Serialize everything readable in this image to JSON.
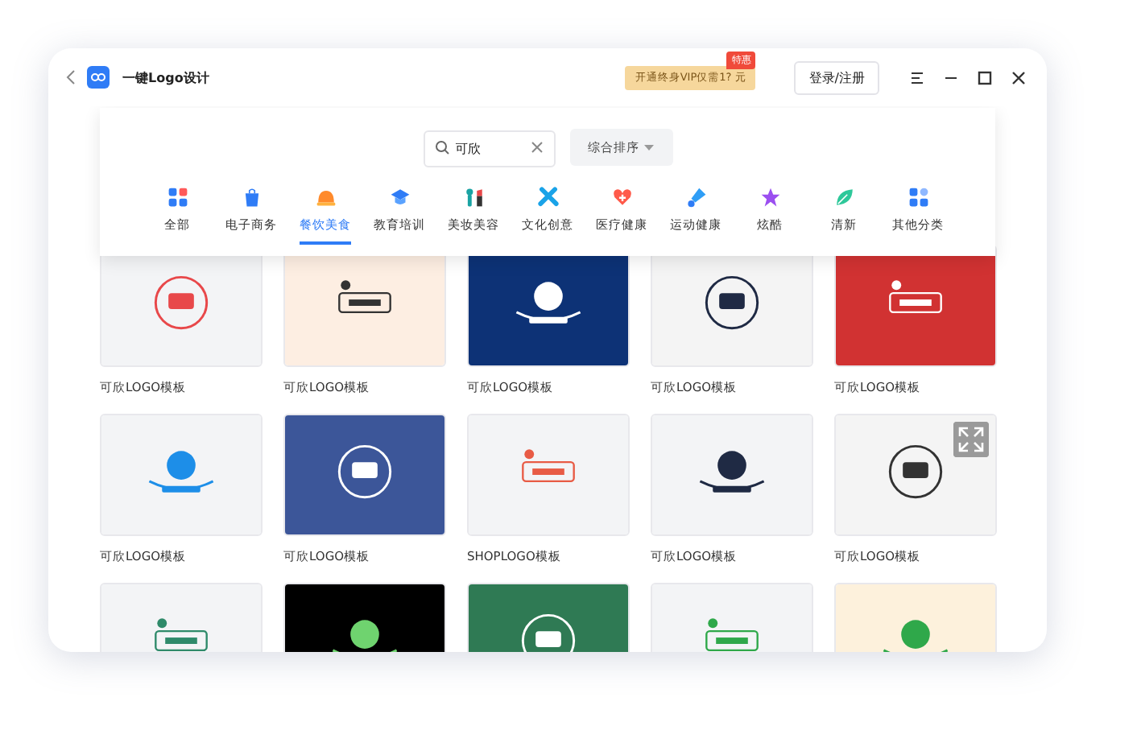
{
  "window": {
    "title": "一键Logo设计"
  },
  "promo": {
    "text": "开通终身VIP仅需1? 元",
    "tag": "特惠"
  },
  "login_button": "登录/注册",
  "search": {
    "value": "可欣"
  },
  "sort": {
    "label": "综合排序"
  },
  "categories": [
    {
      "label": "全部",
      "selected": false
    },
    {
      "label": "电子商务",
      "selected": false
    },
    {
      "label": "餐饮美食",
      "selected": true
    },
    {
      "label": "教育培训",
      "selected": false
    },
    {
      "label": "美妆美容",
      "selected": false
    },
    {
      "label": "文化创意",
      "selected": false
    },
    {
      "label": "医疗健康",
      "selected": false
    },
    {
      "label": "运动健康",
      "selected": false
    },
    {
      "label": "炫酷",
      "selected": false
    },
    {
      "label": "清新",
      "selected": false
    },
    {
      "label": "其他分类",
      "selected": false
    }
  ],
  "templates": [
    {
      "label": "可欣LOGO模板",
      "hovered": false
    },
    {
      "label": "可欣LOGO模板",
      "hovered": false
    },
    {
      "label": "可欣LOGO模板",
      "hovered": false
    },
    {
      "label": "可欣LOGO模板",
      "hovered": false
    },
    {
      "label": "可欣LOGO模板",
      "hovered": false
    },
    {
      "label": "可欣LOGO模板",
      "hovered": false
    },
    {
      "label": "可欣LOGO模板",
      "hovered": false
    },
    {
      "label": "SHOPLOGO模板",
      "hovered": false
    },
    {
      "label": "可欣LOGO模板",
      "hovered": false
    },
    {
      "label": "可欣LOGO模板",
      "hovered": true
    },
    {
      "hovered": false
    },
    {
      "hovered": false
    },
    {
      "hovered": false
    },
    {
      "hovered": false
    },
    {
      "hovered": false
    }
  ]
}
